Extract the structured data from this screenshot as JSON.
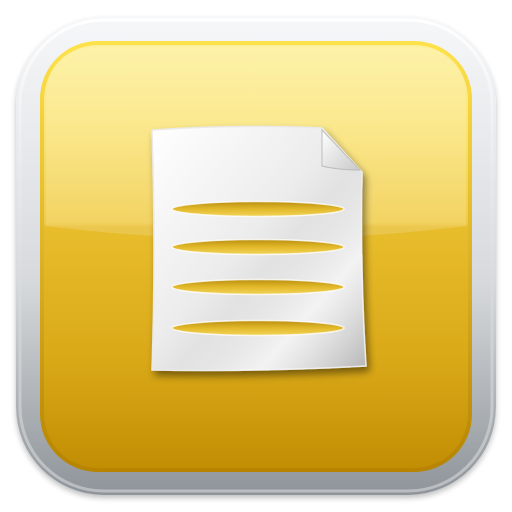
{
  "app_icon": {
    "icon": "document-icon",
    "colors": {
      "background": "#ffffff",
      "bezel_light": "#f4f5f7",
      "bezel_dark": "#9ea3a8",
      "tile_top": "#fbe98a",
      "tile_mid": "#eec63c",
      "tile_bottom": "#c58f02",
      "document_light": "#fafafa",
      "document_shade": "#bdbdbd",
      "text_line": "#d6a918"
    },
    "document": {
      "text_lines": 4,
      "folded_corner": true
    }
  }
}
